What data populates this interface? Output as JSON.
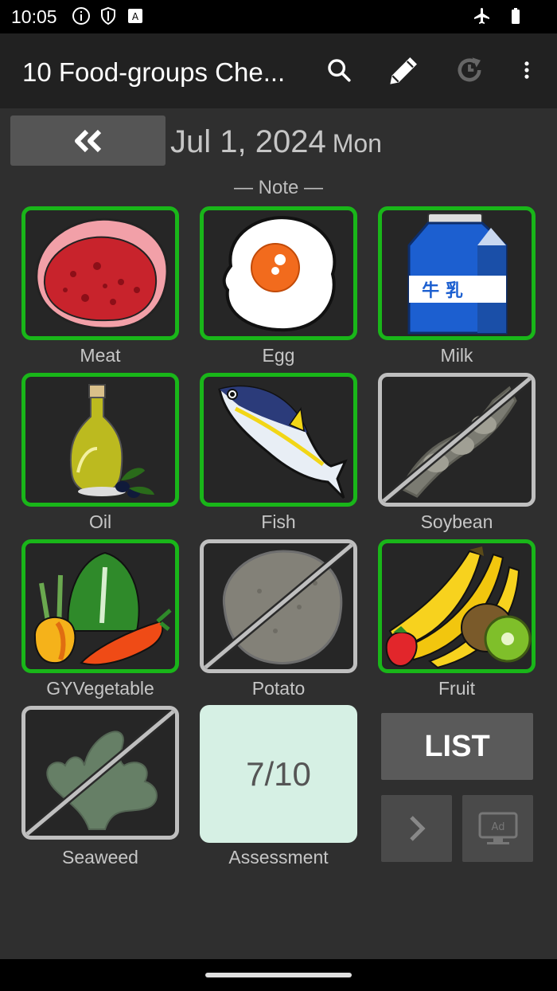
{
  "status": {
    "time": "10:05",
    "icons": [
      "info-icon",
      "shield-icon",
      "keyboard-a-icon",
      "airplane-icon",
      "battery-icon"
    ]
  },
  "appbar": {
    "title": "10 Food-groups Che...",
    "actions": [
      "search-icon",
      "edit-pencil-icon",
      "history-icon",
      "more-vert-icon"
    ]
  },
  "date": {
    "back_glyph": "«",
    "date": "Jul 1, 2024",
    "weekday": "Mon"
  },
  "note": "— Note —",
  "tiles": [
    {
      "label": "Meat",
      "checked": true
    },
    {
      "label": "Egg",
      "checked": true
    },
    {
      "label": "Milk",
      "checked": true
    },
    {
      "label": "Oil",
      "checked": true
    },
    {
      "label": "Fish",
      "checked": true
    },
    {
      "label": "Soybean",
      "checked": false
    },
    {
      "label": "GYVegetable",
      "checked": true
    },
    {
      "label": "Potato",
      "checked": false
    },
    {
      "label": "Fruit",
      "checked": true
    },
    {
      "label": "Seaweed",
      "checked": false
    }
  ],
  "milk_text": "牛 乳",
  "assessment": {
    "value": "7/10",
    "label": "Assessment"
  },
  "buttons": {
    "list": "LIST",
    "ad_text": "Ad"
  },
  "colors": {
    "checked": "#19b619",
    "unchecked": "#bfbfbf",
    "assessment_bg": "#d6f0e4"
  }
}
